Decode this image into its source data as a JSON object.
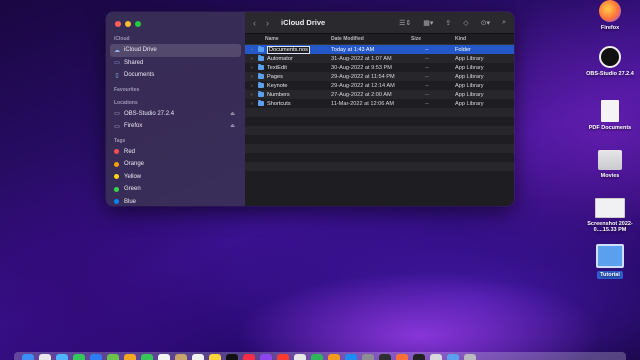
{
  "window": {
    "title": "iCloud Drive",
    "sidebar": {
      "sections": [
        {
          "header": "iCloud",
          "items": [
            {
              "label": "iCloud Drive",
              "icon": "cloud-icon",
              "selected": true
            },
            {
              "label": "Shared",
              "icon": "shared-folder-icon"
            },
            {
              "label": "Documents",
              "icon": "document-icon"
            }
          ]
        },
        {
          "header": "Favourites",
          "items": []
        },
        {
          "header": "Locations",
          "items": [
            {
              "label": "OBS-Studio 27.2.4",
              "icon": "disk-icon",
              "eject": true
            },
            {
              "label": "Firefox",
              "icon": "disk-icon",
              "eject": true
            }
          ]
        },
        {
          "header": "Tags",
          "items": [
            {
              "label": "Red",
              "color": "#ff4f4f"
            },
            {
              "label": "Orange",
              "color": "#ff9f0a"
            },
            {
              "label": "Yellow",
              "color": "#ffd60a"
            },
            {
              "label": "Green",
              "color": "#32d74b"
            },
            {
              "label": "Blue",
              "color": "#0a84ff"
            }
          ]
        }
      ]
    },
    "columns": {
      "name": "Name",
      "date": "Date Modified",
      "size": "Size",
      "kind": "Kind"
    },
    "files": [
      {
        "name": "Documents.nosync",
        "name_display": "Documents.nos",
        "date": "Today at 1:43 AM",
        "size": "--",
        "kind": "Folder",
        "selected": true,
        "renaming": true
      },
      {
        "name": "Automator",
        "date": "31-Aug-2022 at 1:07 AM",
        "size": "--",
        "kind": "App Library"
      },
      {
        "name": "TextEdit",
        "date": "30-Aug-2022 at 9:53 PM",
        "size": "--",
        "kind": "App Library"
      },
      {
        "name": "Pages",
        "date": "29-Aug-2022 at 11:54 PM",
        "size": "--",
        "kind": "App Library"
      },
      {
        "name": "Keynote",
        "date": "29-Aug-2022 at 12:14 AM",
        "size": "--",
        "kind": "App Library"
      },
      {
        "name": "Numbers",
        "date": "27-Aug-2022 at 2:00 AM",
        "size": "--",
        "kind": "App Library"
      },
      {
        "name": "Shortcuts",
        "date": "11-Mar-2022 at 12:06 AM",
        "size": "--",
        "kind": "App Library"
      }
    ]
  },
  "desktop": [
    {
      "label": "Firefox",
      "icon": "firefox-icon"
    },
    {
      "label": "OBS-Studio 27.2.4",
      "icon": "obs-disk-icon"
    },
    {
      "label": "PDF Documents",
      "icon": "pdf-folder-icon"
    },
    {
      "label": "Movies",
      "icon": "movies-icon"
    },
    {
      "label": "Screenshot 2022-0....15.33 PM",
      "icon": "screenshot-thumbnail-icon"
    },
    {
      "label": "Tutorial",
      "icon": "folder-icon",
      "selected": true
    }
  ]
}
